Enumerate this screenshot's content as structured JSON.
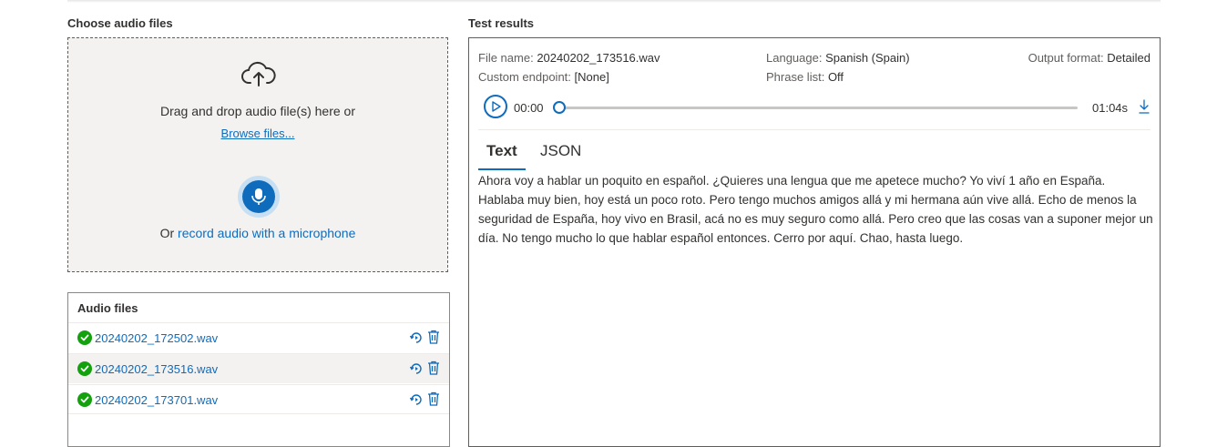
{
  "left": {
    "heading": "Choose audio files",
    "dropzone": {
      "icon": "cloud-upload-icon",
      "drag_text": "Drag and drop audio file(s) here or",
      "browse_label": "Browse files...",
      "record_prefix": "Or ",
      "record_link": "record audio with a microphone",
      "mic_icon": "microphone-icon"
    },
    "files": {
      "title": "Audio files",
      "items": [
        {
          "name": "20240202_172502.wav",
          "status": "success",
          "selected": false
        },
        {
          "name": "20240202_173516.wav",
          "status": "success",
          "selected": true
        },
        {
          "name": "20240202_173701.wav",
          "status": "success",
          "selected": false
        }
      ]
    }
  },
  "results": {
    "heading": "Test results",
    "file_name_label": "File name:",
    "file_name": "20240202_173516.wav",
    "language_label": "Language:",
    "language": "Spanish (Spain)",
    "output_format_label": "Output format:",
    "output_format": "Detailed",
    "endpoint_label": "Custom endpoint:",
    "endpoint": "[None]",
    "phrase_label": "Phrase list:",
    "phrase": "Off",
    "player": {
      "current_time": "00:00",
      "total_time": "01:04s",
      "progress": 0
    },
    "tabs": [
      {
        "label": "Text",
        "active": true
      },
      {
        "label": "JSON",
        "active": false
      }
    ],
    "transcript": "Ahora voy a hablar un poquito en español. ¿Quieres una lengua que me apetece mucho? Yo viví 1 año en España. Hablaba muy bien, hoy está un poco roto. Pero tengo muchos amigos allá y mi hermana aún vive allá. Echo de menos la seguridad de España, hoy vivo en Brasil, acá no es muy seguro como allá. Pero creo que las cosas van a suponer mejor un día. No tengo mucho lo que hablar español entonces. Cerro por aquí. Chao, hasta luego."
  },
  "colors": {
    "accent": "#0f6cbd",
    "success": "#13a10e",
    "dropzone_bg": "#f3f2f1"
  }
}
